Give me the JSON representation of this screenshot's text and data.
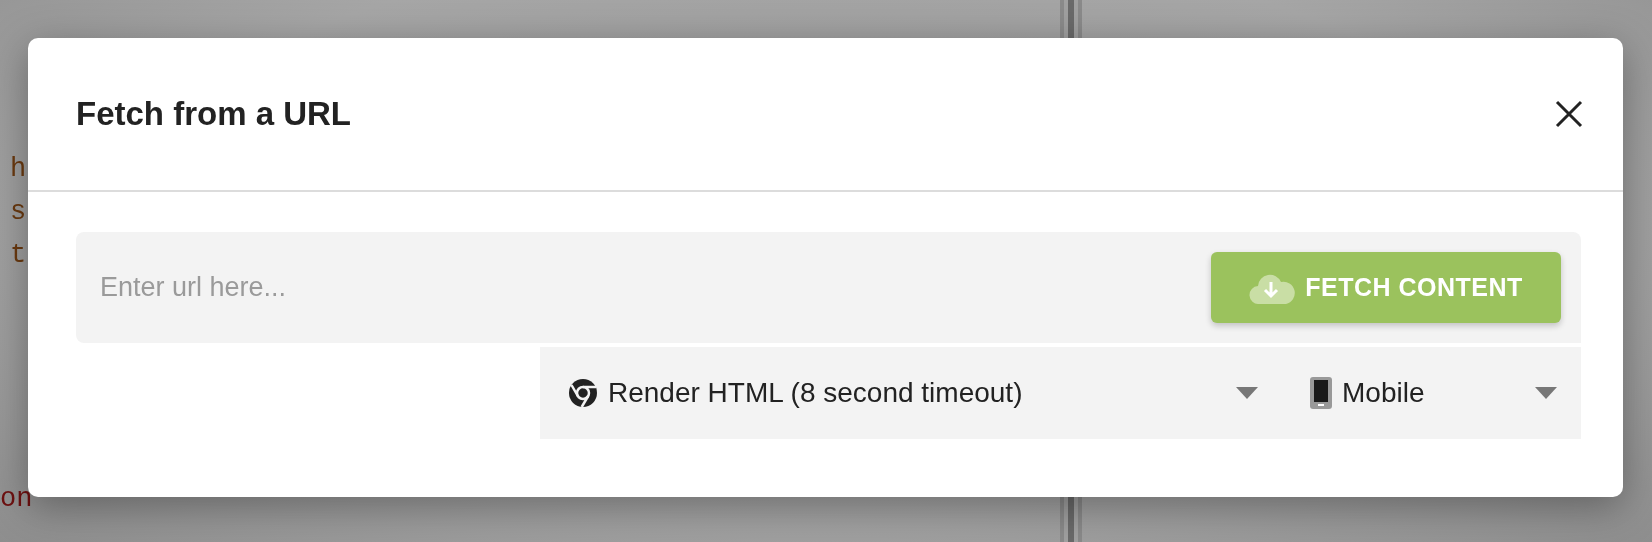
{
  "background": {
    "code_top": [
      {
        "text": "h",
        "kind": "string"
      },
      {
        "text": "s",
        "kind": "string"
      },
      {
        "text": "t",
        "kind": "string"
      }
    ],
    "code_bottom": {
      "text": "on",
      "kind": "keyword"
    }
  },
  "dialog": {
    "title": "Fetch from a URL",
    "url_field": {
      "placeholder": "Enter url here..."
    },
    "fetch_button": {
      "label": "FETCH CONTENT"
    },
    "dropdowns": [
      {
        "kind": "renderer",
        "value": "Render HTML (8 second timeout)"
      },
      {
        "kind": "device",
        "value": "Mobile"
      }
    ]
  }
}
